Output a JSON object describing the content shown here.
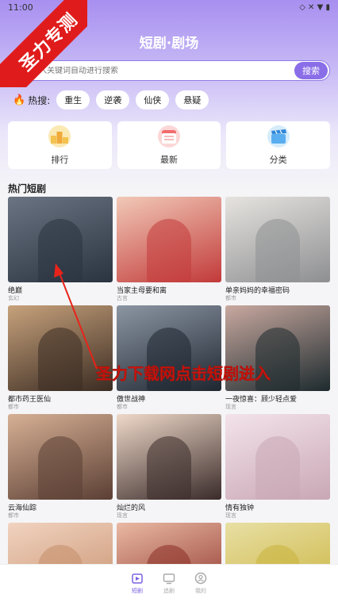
{
  "status_bar": {
    "time": "11:00",
    "icons": "◇ ✕ ▼ ▮"
  },
  "watermark": {
    "corner_text": "圣力专测",
    "overlay_text": "圣力下载网点击短剧进入"
  },
  "header": {
    "title": "短剧·剧场"
  },
  "search": {
    "placeholder": "输入关键词自动进行搜索",
    "button_label": "搜索"
  },
  "hot": {
    "label": "热搜:",
    "chips": [
      "重生",
      "逆袭",
      "仙侠",
      "悬疑"
    ]
  },
  "categories": [
    {
      "label": "排行",
      "icon": "ranking-icon"
    },
    {
      "label": "最新",
      "icon": "calendar-icon"
    },
    {
      "label": "分类",
      "icon": "clapperboard-icon"
    }
  ],
  "section": {
    "title": "热门短剧"
  },
  "dramas": [
    {
      "title": "绝巅",
      "tag": "玄幻",
      "color_a": "#2a3340",
      "color_b": "#6b7482"
    },
    {
      "title": "当家主母要和离",
      "tag": "古言",
      "color_a": "#c23a3a",
      "color_b": "#f1c9b7"
    },
    {
      "title": "单亲妈妈的幸福密码",
      "tag": "都市",
      "color_a": "#8e8f92",
      "color_b": "#e6e3df"
    },
    {
      "title": "都市药王医仙",
      "tag": "都市",
      "color_a": "#3a2b22",
      "color_b": "#c7a27c"
    },
    {
      "title": "傲世战神",
      "tag": "都市",
      "color_a": "#1e2630",
      "color_b": "#8c96a3"
    },
    {
      "title": "一夜惊喜：顾少轻点爱",
      "tag": "现言",
      "color_a": "#1d2a2e",
      "color_b": "#c9a9a0"
    },
    {
      "title": "云海仙踪",
      "tag": "都市",
      "color_a": "#5b3f34",
      "color_b": "#d7b095"
    },
    {
      "title": "灿烂的风",
      "tag": "现言",
      "color_a": "#3a2b2a",
      "color_b": "#efd9c9"
    },
    {
      "title": "情有独钟",
      "tag": "现言",
      "color_a": "#c9a7b5",
      "color_b": "#f3e3ea"
    },
    {
      "title": "",
      "tag": "",
      "color_a": "#c58e6a",
      "color_b": "#f1d3c0"
    },
    {
      "title": "",
      "tag": "",
      "color_a": "#8a2d24",
      "color_b": "#e9b9a4"
    },
    {
      "title": "",
      "tag": "",
      "color_a": "#c9b23a",
      "color_b": "#e8dfa4"
    }
  ],
  "bottom_nav": [
    {
      "label": "短剧",
      "icon": "home-icon",
      "active": true
    },
    {
      "label": "追剧",
      "icon": "tv-icon",
      "active": false
    },
    {
      "label": "我的",
      "icon": "user-icon",
      "active": false
    }
  ],
  "colors": {
    "accent": "#8a6ee8",
    "watermark_red": "#e01b1b"
  }
}
